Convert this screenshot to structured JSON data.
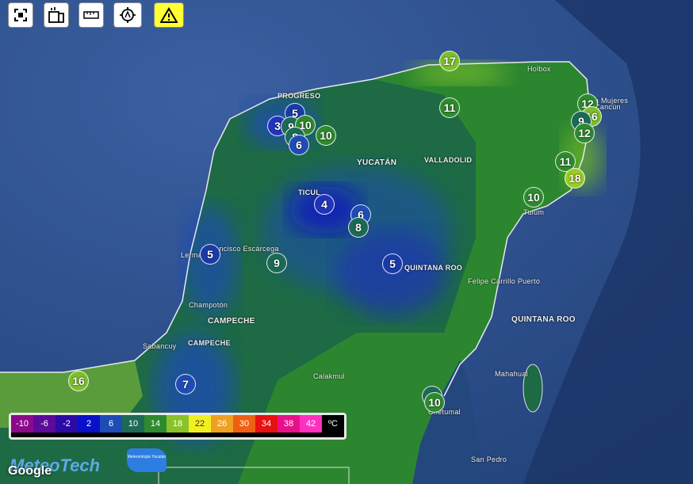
{
  "toolbar": {
    "buttons": [
      {
        "name": "fullscreen-button",
        "icon": "fullscreen-icon"
      },
      {
        "name": "stations-button",
        "icon": "station-icon"
      },
      {
        "name": "ruler-button",
        "icon": "ruler-icon"
      },
      {
        "name": "locate-button",
        "icon": "locate-icon"
      },
      {
        "name": "alert-button",
        "icon": "warning-icon"
      }
    ]
  },
  "markers": [
    {
      "value": "17",
      "color": "#7bbf2a"
    },
    {
      "value": "11",
      "color": "#2e8a2e"
    },
    {
      "value": "12",
      "color": "#2e8a2e"
    },
    {
      "value": "16",
      "color": "#7bbf2a"
    },
    {
      "value": "9",
      "color": "#1c6a55"
    },
    {
      "value": "12",
      "color": "#2e8a2e"
    },
    {
      "value": "11",
      "color": "#2e8a2e"
    },
    {
      "value": "18",
      "color": "#9acd20"
    },
    {
      "value": "10",
      "color": "#2e8a2e"
    },
    {
      "value": "3",
      "color": "#2233bb"
    },
    {
      "value": "5",
      "color": "#1a3aa8"
    },
    {
      "value": "9",
      "color": "#1c6a55"
    },
    {
      "value": "10",
      "color": "#2e8a2e"
    },
    {
      "value": "8",
      "color": "#1c6a55"
    },
    {
      "value": "6",
      "color": "#1f4bb5"
    },
    {
      "value": "10",
      "color": "#2e8a2e"
    },
    {
      "value": "4",
      "color": "#2233bb"
    },
    {
      "value": "6",
      "color": "#1f4bb5"
    },
    {
      "value": "8",
      "color": "#1c6a55"
    },
    {
      "value": "5",
      "color": "#1a3aa8"
    },
    {
      "value": "9",
      "color": "#1c6a55"
    },
    {
      "value": "5",
      "color": "#1a3aa8"
    },
    {
      "value": "16",
      "color": "#7bbf2a"
    },
    {
      "value": "7",
      "color": "#1f4bb5"
    },
    {
      "value": "9",
      "color": "#1c6a55"
    },
    {
      "value": "10",
      "color": "#2e8a2e"
    }
  ],
  "places": [
    "PROGRESO",
    "YUCATÁN",
    "VALLADOLID",
    "TICUL",
    "QUINTANA ROO",
    "QUINTANA ROO",
    "CAMPECHE",
    "CAMPECHE",
    "Cancún",
    "Tulum",
    "Felipe Carrillo Puerto",
    "Mahahual",
    "Calakmul",
    "Chetumal",
    "San Pedro",
    "Francisco Escárcega",
    "Champotón",
    "Lerma",
    "Sabancuy",
    "Isla Mujeres",
    "Holbox"
  ],
  "legend": [
    {
      "label": "-10",
      "color": "#8a0a8a"
    },
    {
      "label": "-6",
      "color": "#5b0a9a"
    },
    {
      "label": "-2",
      "color": "#2c0aa6"
    },
    {
      "label": "2",
      "color": "#0a10c8"
    },
    {
      "label": "6",
      "color": "#1f4bb5"
    },
    {
      "label": "10",
      "color": "#1c6a55"
    },
    {
      "label": "14",
      "color": "#2e8a2e"
    },
    {
      "label": "18",
      "color": "#8ac22a"
    },
    {
      "label": "22",
      "color": "#f0f020"
    },
    {
      "label": "26",
      "color": "#f0a020"
    },
    {
      "label": "30",
      "color": "#f06010"
    },
    {
      "label": "34",
      "color": "#e81010"
    },
    {
      "label": "38",
      "color": "#e8108a"
    },
    {
      "label": "42",
      "color": "#ff30c0"
    },
    {
      "label": "ºC",
      "color": "#000000"
    }
  ],
  "branding": {
    "logo": "MeteoTech",
    "badge": "Meteorología Yucatán",
    "google": "Google"
  }
}
